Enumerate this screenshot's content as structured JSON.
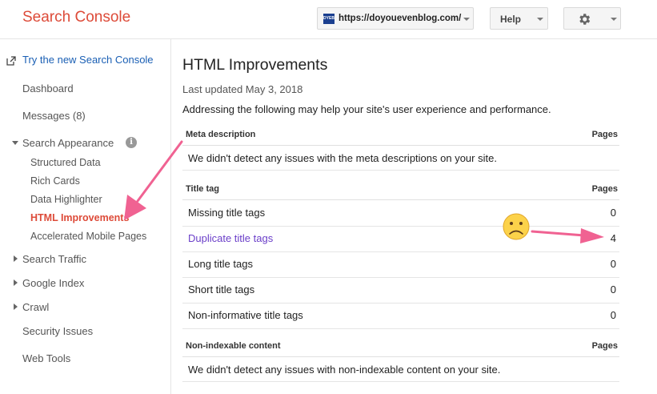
{
  "header": {
    "logo": "Search Console",
    "site_favicon": "DYEB",
    "site_url": "https://doyouevenblog.com/",
    "help_label": "Help",
    "settings_icon": "gear-icon"
  },
  "sidebar": {
    "try_new": "Try the new Search Console",
    "dashboard": "Dashboard",
    "messages": "Messages (8)",
    "search_appearance": "Search Appearance",
    "sub_items": [
      "Structured Data",
      "Rich Cards",
      "Data Highlighter",
      "HTML Improvements",
      "Accelerated Mobile Pages"
    ],
    "search_traffic": "Search Traffic",
    "google_index": "Google Index",
    "crawl": "Crawl",
    "security_issues": "Security Issues",
    "web_tools": "Web Tools"
  },
  "main": {
    "title": "HTML Improvements",
    "last_updated": "Last updated May 3, 2018",
    "intro": "Addressing the following may help your site's user experience and performance.",
    "meta_section": {
      "header": "Meta description",
      "pages_header": "Pages",
      "message": "We didn't detect any issues with the meta descriptions on your site."
    },
    "title_section": {
      "header": "Title tag",
      "pages_header": "Pages",
      "rows": [
        {
          "label": "Missing title tags",
          "count": "0"
        },
        {
          "label": "Duplicate title tags",
          "count": "4"
        },
        {
          "label": "Long title tags",
          "count": "0"
        },
        {
          "label": "Short title tags",
          "count": "0"
        },
        {
          "label": "Non-informative title tags",
          "count": "0"
        }
      ]
    },
    "nonindex_section": {
      "header": "Non-indexable content",
      "pages_header": "Pages",
      "message": "We didn't detect any issues with non-indexable content on your site."
    }
  },
  "colors": {
    "accent_red": "#dd4b39",
    "link_blue": "#1a5fb4",
    "link_purple": "#6b3fc9",
    "annotation_pink": "#f06292"
  }
}
